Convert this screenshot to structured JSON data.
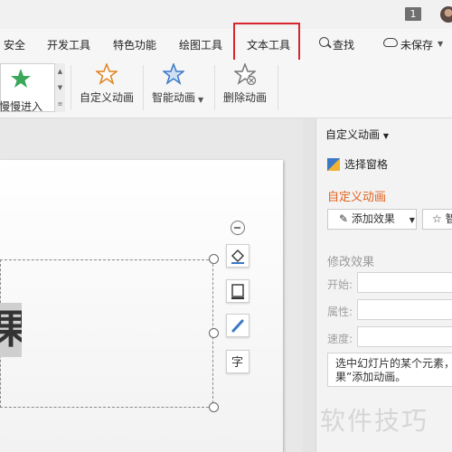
{
  "titlebar": {
    "badge": "1"
  },
  "tabs": [
    {
      "label": "安全"
    },
    {
      "label": "开发工具"
    },
    {
      "label": "特色功能"
    },
    {
      "label": "绘图工具"
    },
    {
      "label": "文本工具"
    },
    {
      "label": "查找"
    },
    {
      "label": "未保存"
    }
  ],
  "ribbon": {
    "gallery_label": "慢慢进入",
    "custom_animation": "自定义动画",
    "smart_animation": "智能动画",
    "delete_animation": "删除动画"
  },
  "slide": {
    "visible_char": "果"
  },
  "pane": {
    "title": "自定义动画",
    "select_pane": "选择窗格",
    "heading": "自定义动画",
    "add_effect": "添加效果",
    "second_button": "智",
    "modify_effect": "修改效果",
    "start_label": "开始:",
    "property_label": "属性:",
    "speed_label": "速度:",
    "hint_text": "选中幻灯片的某个元素，果”添加动画。"
  },
  "watermark": "软件技巧",
  "colors": {
    "highlight_frame": "#d9262c",
    "pane_heading": "#e2621b"
  }
}
